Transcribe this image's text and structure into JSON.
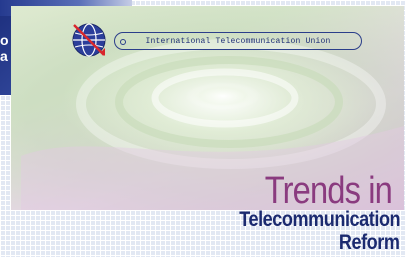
{
  "cover": {
    "organization": "International Telecommunication Union",
    "title_line1": "Trends in",
    "title_line2": "Telecommunication",
    "title_line3": "Reform",
    "logo_icon": "itu-globe-logo-icon"
  },
  "background_panel": {
    "partial_text": [
      "o",
      "a"
    ]
  },
  "colors": {
    "title_purple": "#8a3b7f",
    "title_navy": "#1b2a6f",
    "accent_red": "#d8262c",
    "panel_blue": "#2a3f92"
  }
}
